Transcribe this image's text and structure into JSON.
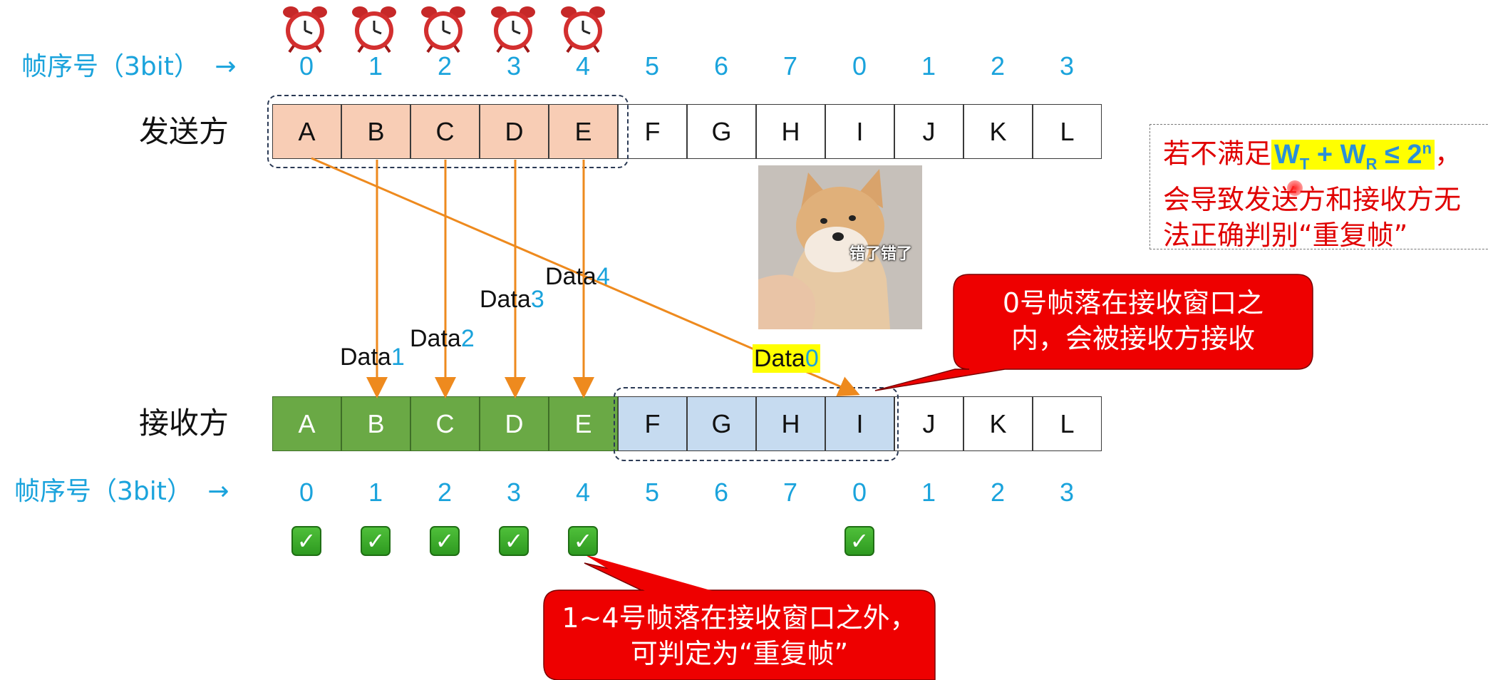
{
  "seq_label": "帧序号（3bit）",
  "arrow_glyph": "→",
  "seq_numbers": [
    "0",
    "1",
    "2",
    "3",
    "4",
    "5",
    "6",
    "7",
    "0",
    "1",
    "2",
    "3"
  ],
  "sender": {
    "label": "发送方",
    "frames": [
      "A",
      "B",
      "C",
      "D",
      "E",
      "F",
      "G",
      "H",
      "I",
      "J",
      "K",
      "L"
    ]
  },
  "receiver": {
    "label": "接收方",
    "frames": [
      "A",
      "B",
      "C",
      "D",
      "E",
      "F",
      "G",
      "H",
      "I",
      "J",
      "K",
      "L"
    ]
  },
  "data_labels": [
    {
      "prefix": "Data",
      "num": "1"
    },
    {
      "prefix": "Data",
      "num": "2"
    },
    {
      "prefix": "Data",
      "num": "3"
    },
    {
      "prefix": "Data",
      "num": "4"
    },
    {
      "prefix": "Data",
      "num": "0"
    }
  ],
  "callouts": {
    "top_line1": "0号帧落在接收窗口之",
    "top_line2": "内，会被接收方接收",
    "bottom_line1": "1~4号帧落在接收窗口之外，",
    "bottom_line2": "可判定为“重复帧”"
  },
  "note": {
    "line1_prefix": "若不满足",
    "formula_w": "W",
    "formula_t": "T",
    "formula_plus": " + W",
    "formula_r": "R",
    "formula_le": " ≤ 2",
    "formula_n": "n",
    "line1_suffix": "，",
    "line2": "会导致发送方和接收方无",
    "line3": "法正确判别“重复帧”"
  },
  "meme": {
    "caption": "错了错了"
  },
  "checkmark_glyph": "✓",
  "colors": {
    "sequence": "#1aa3dc",
    "sent_fill": "#f8cdb5",
    "received_fill": "#6aa945",
    "window_fill": "#c6dbf0",
    "arrow": "#ee8a1e",
    "callout": "#ee0000",
    "note_text": "#e00000",
    "highlight": "#ffff00"
  },
  "icons": [
    "alarm-clock-icon",
    "check-icon",
    "arrow-right-icon"
  ]
}
